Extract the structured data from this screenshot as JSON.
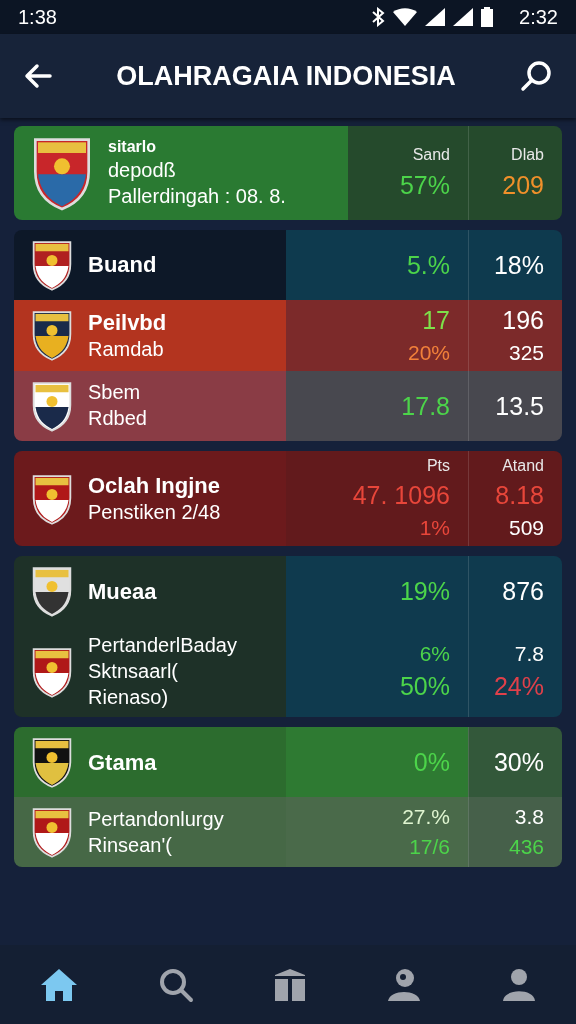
{
  "status_bar": {
    "time": "1:38",
    "clock": "2:32"
  },
  "app_bar": {
    "title": "OLAHRAGAIA INDONESIA"
  },
  "cards": [
    {
      "rows": [
        {
          "kind": "grass",
          "lines": [
            {
              "kind": "caption",
              "text": "sitarlo"
            },
            {
              "kind": "detail",
              "text": "depodß"
            },
            {
              "kind": "detail",
              "text": "Pallerdingah : 08. 8."
            }
          ],
          "columns": [
            [
              {
                "kind": "header",
                "text": "Sand"
              },
              {
                "kind": "value",
                "text": "57%",
                "color": "#4cd44a"
              }
            ],
            [
              {
                "kind": "header",
                "text": "Dlab"
              },
              {
                "kind": "value",
                "text": "209",
                "color": "#f0902a"
              }
            ]
          ]
        }
      ]
    },
    {
      "rows": [
        {
          "kind": "navy",
          "lines": [
            {
              "kind": "name",
              "text": "Buand"
            }
          ],
          "columns": [
            [
              {
                "kind": "value",
                "text": "5.%",
                "color": "#4cd44a"
              }
            ],
            [
              {
                "kind": "value",
                "text": "18%",
                "color": "#ffffff"
              }
            ]
          ]
        },
        {
          "kind": "red",
          "lines": [
            {
              "kind": "name",
              "text": "Peilvbd"
            },
            {
              "kind": "detail",
              "text": "Ramdab"
            }
          ],
          "columns": [
            [
              {
                "kind": "value",
                "text": "17",
                "color": "#7ee04a"
              },
              {
                "kind": "small",
                "text": "20%",
                "color": "#f2803a"
              }
            ],
            [
              {
                "kind": "value",
                "text": "196",
                "color": "#ffffff"
              },
              {
                "kind": "small",
                "text": "325",
                "color": "#ffffff"
              }
            ]
          ]
        },
        {
          "kind": "rose",
          "lines": [
            {
              "kind": "detail",
              "text": "Sbem"
            },
            {
              "kind": "detail",
              "text": "Rdbed"
            }
          ],
          "columns": [
            [
              {
                "kind": "value",
                "text": "17.8",
                "color": "#4cd44a"
              }
            ],
            [
              {
                "kind": "value",
                "text": "13.5",
                "color": "#ffffff"
              }
            ]
          ]
        }
      ]
    },
    {
      "rows": [
        {
          "kind": "maroon",
          "lines": [
            {
              "kind": "name",
              "text": "Oclah Ingjne"
            },
            {
              "kind": "detail",
              "text": "Penstiken 2/48"
            }
          ],
          "columns": [
            [
              {
                "kind": "header",
                "text": "Pts"
              },
              {
                "kind": "value",
                "text": "47. 1096",
                "color": "#e8463a"
              },
              {
                "kind": "small",
                "text": "1%",
                "color": "#e8463a"
              }
            ],
            [
              {
                "kind": "header",
                "text": "Atand"
              },
              {
                "kind": "value",
                "text": "8.18",
                "color": "#e8463a"
              },
              {
                "kind": "small",
                "text": "509",
                "color": "#ffffff"
              }
            ]
          ]
        }
      ]
    },
    {
      "rows": [
        {
          "kind": "forest",
          "lines": [
            {
              "kind": "name",
              "text": "Mueaa"
            }
          ],
          "columns": [
            [
              {
                "kind": "value",
                "text": "19%",
                "color": "#4cd44a"
              }
            ],
            [
              {
                "kind": "value",
                "text": "876",
                "color": "#ffffff"
              }
            ]
          ]
        },
        {
          "kind": "forest",
          "lines": [
            {
              "kind": "detail",
              "text": "PertanderlBaday"
            },
            {
              "kind": "detail",
              "text": "Sktnsaarl("
            },
            {
              "kind": "detail",
              "text": "Rienaso)"
            }
          ],
          "columns": [
            [
              {
                "kind": "small",
                "text": "6%",
                "color": "#4cd44a"
              },
              {
                "kind": "value",
                "text": "50%",
                "color": "#4cd44a"
              }
            ],
            [
              {
                "kind": "small",
                "text": "7.8",
                "color": "#ffffff"
              },
              {
                "kind": "value",
                "text": "24%",
                "color": "#e0404a"
              }
            ]
          ]
        }
      ]
    },
    {
      "rows": [
        {
          "kind": "lime",
          "lines": [
            {
              "kind": "name",
              "text": "Gtama"
            }
          ],
          "columns": [
            [
              {
                "kind": "value",
                "text": "0%",
                "color": "#4cd44a"
              }
            ],
            [
              {
                "kind": "value",
                "text": "30%",
                "color": "#ffffff"
              }
            ]
          ]
        },
        {
          "kind": "olive",
          "lines": [
            {
              "kind": "detail",
              "text": "Pertandonlurgy"
            },
            {
              "kind": "detail",
              "text": "Rinsean'("
            }
          ],
          "columns": [
            [
              {
                "kind": "small",
                "text": "27.%",
                "color": "#dff5d0"
              },
              {
                "kind": "small",
                "text": "17/6",
                "color": "#4cd44a"
              }
            ],
            [
              {
                "kind": "small",
                "text": "3.8",
                "color": "#ffffff"
              },
              {
                "kind": "small",
                "text": "436",
                "color": "#4cd44a"
              }
            ]
          ]
        }
      ]
    }
  ],
  "nav": [
    {
      "kind": "home",
      "selected": true
    },
    {
      "kind": "search",
      "selected": false
    },
    {
      "kind": "box",
      "selected": false
    },
    {
      "kind": "badge",
      "selected": false
    },
    {
      "kind": "profile",
      "selected": false
    }
  ]
}
